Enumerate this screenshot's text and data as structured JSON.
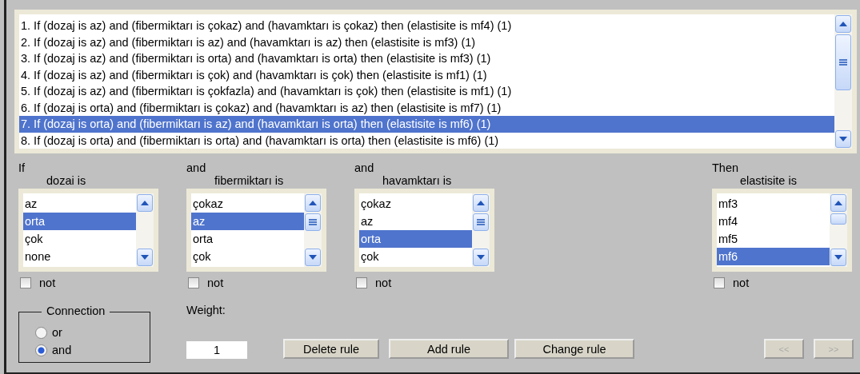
{
  "rules": [
    {
      "text": "1. If (dozaj is az) and (fibermiktarı is çokaz) and (havamktarı is çokaz) then (elastisite is mf4) (1)",
      "selected": false
    },
    {
      "text": "2. If (dozaj is az) and (fibermiktarı is az) and (havamktarı is az) then (elastisite is mf3) (1)",
      "selected": false
    },
    {
      "text": "3. If (dozaj is az) and (fibermiktarı is orta) and (havamktarı is orta) then (elastisite is mf3) (1)",
      "selected": false
    },
    {
      "text": "4. If (dozaj is az) and (fibermiktarı is çok) and (havamktarı is çok) then (elastisite is mf1) (1)",
      "selected": false
    },
    {
      "text": "5. If (dozaj is az) and (fibermiktarı is çokfazla) and (havamktarı is çok) then (elastisite is mf1) (1)",
      "selected": false
    },
    {
      "text": "6. If (dozaj is orta) and (fibermiktarı is çokaz) and (havamktarı is az) then (elastisite is mf7) (1)",
      "selected": false
    },
    {
      "text": "7. If (dozaj is orta) and (fibermiktarı is az) and (havamktarı is orta) then (elastisite is mf6) (1)",
      "selected": true
    },
    {
      "text": "8. If (dozaj is orta) and (fibermiktarı is orta) and (havamktarı is orta) then (elastisite is mf6) (1)",
      "selected": false
    }
  ],
  "variables": [
    {
      "connector": "If",
      "label": "dozai is",
      "options": [
        {
          "text": "az",
          "selected": false
        },
        {
          "text": "orta",
          "selected": true
        },
        {
          "text": "çok",
          "selected": false
        },
        {
          "text": "none",
          "selected": false
        }
      ],
      "not": {
        "label": "not",
        "checked": false
      }
    },
    {
      "connector": "and",
      "label": "fibermiktarı is",
      "options": [
        {
          "text": "çokaz",
          "selected": false
        },
        {
          "text": "az",
          "selected": true
        },
        {
          "text": "orta",
          "selected": false
        },
        {
          "text": "çok",
          "selected": false
        }
      ],
      "not": {
        "label": "not",
        "checked": false
      }
    },
    {
      "connector": "and",
      "label": "havamktarı is",
      "options": [
        {
          "text": "çokaz",
          "selected": false
        },
        {
          "text": "az",
          "selected": false
        },
        {
          "text": "orta",
          "selected": true
        },
        {
          "text": "çok",
          "selected": false
        }
      ],
      "not": {
        "label": "not",
        "checked": false
      }
    }
  ],
  "output": {
    "connector": "Then",
    "label": "elastisite is",
    "options": [
      {
        "text": "mf3",
        "selected": false
      },
      {
        "text": "mf4",
        "selected": false
      },
      {
        "text": "mf5",
        "selected": false
      },
      {
        "text": "mf6",
        "selected": true
      }
    ],
    "not": {
      "label": "not",
      "checked": false
    }
  },
  "connection": {
    "title": "Connection",
    "options": [
      {
        "label": "or",
        "selected": false
      },
      {
        "label": "and",
        "selected": true
      }
    ]
  },
  "weight": {
    "label": "Weight:",
    "value": "1"
  },
  "buttons": [
    {
      "label": "Delete rule",
      "disabled": false
    },
    {
      "label": "Add rule",
      "disabled": false
    },
    {
      "label": "Change rule",
      "disabled": false
    }
  ],
  "nav_buttons": [
    {
      "label": "<<",
      "disabled": true
    },
    {
      "label": ">>",
      "disabled": true
    }
  ]
}
